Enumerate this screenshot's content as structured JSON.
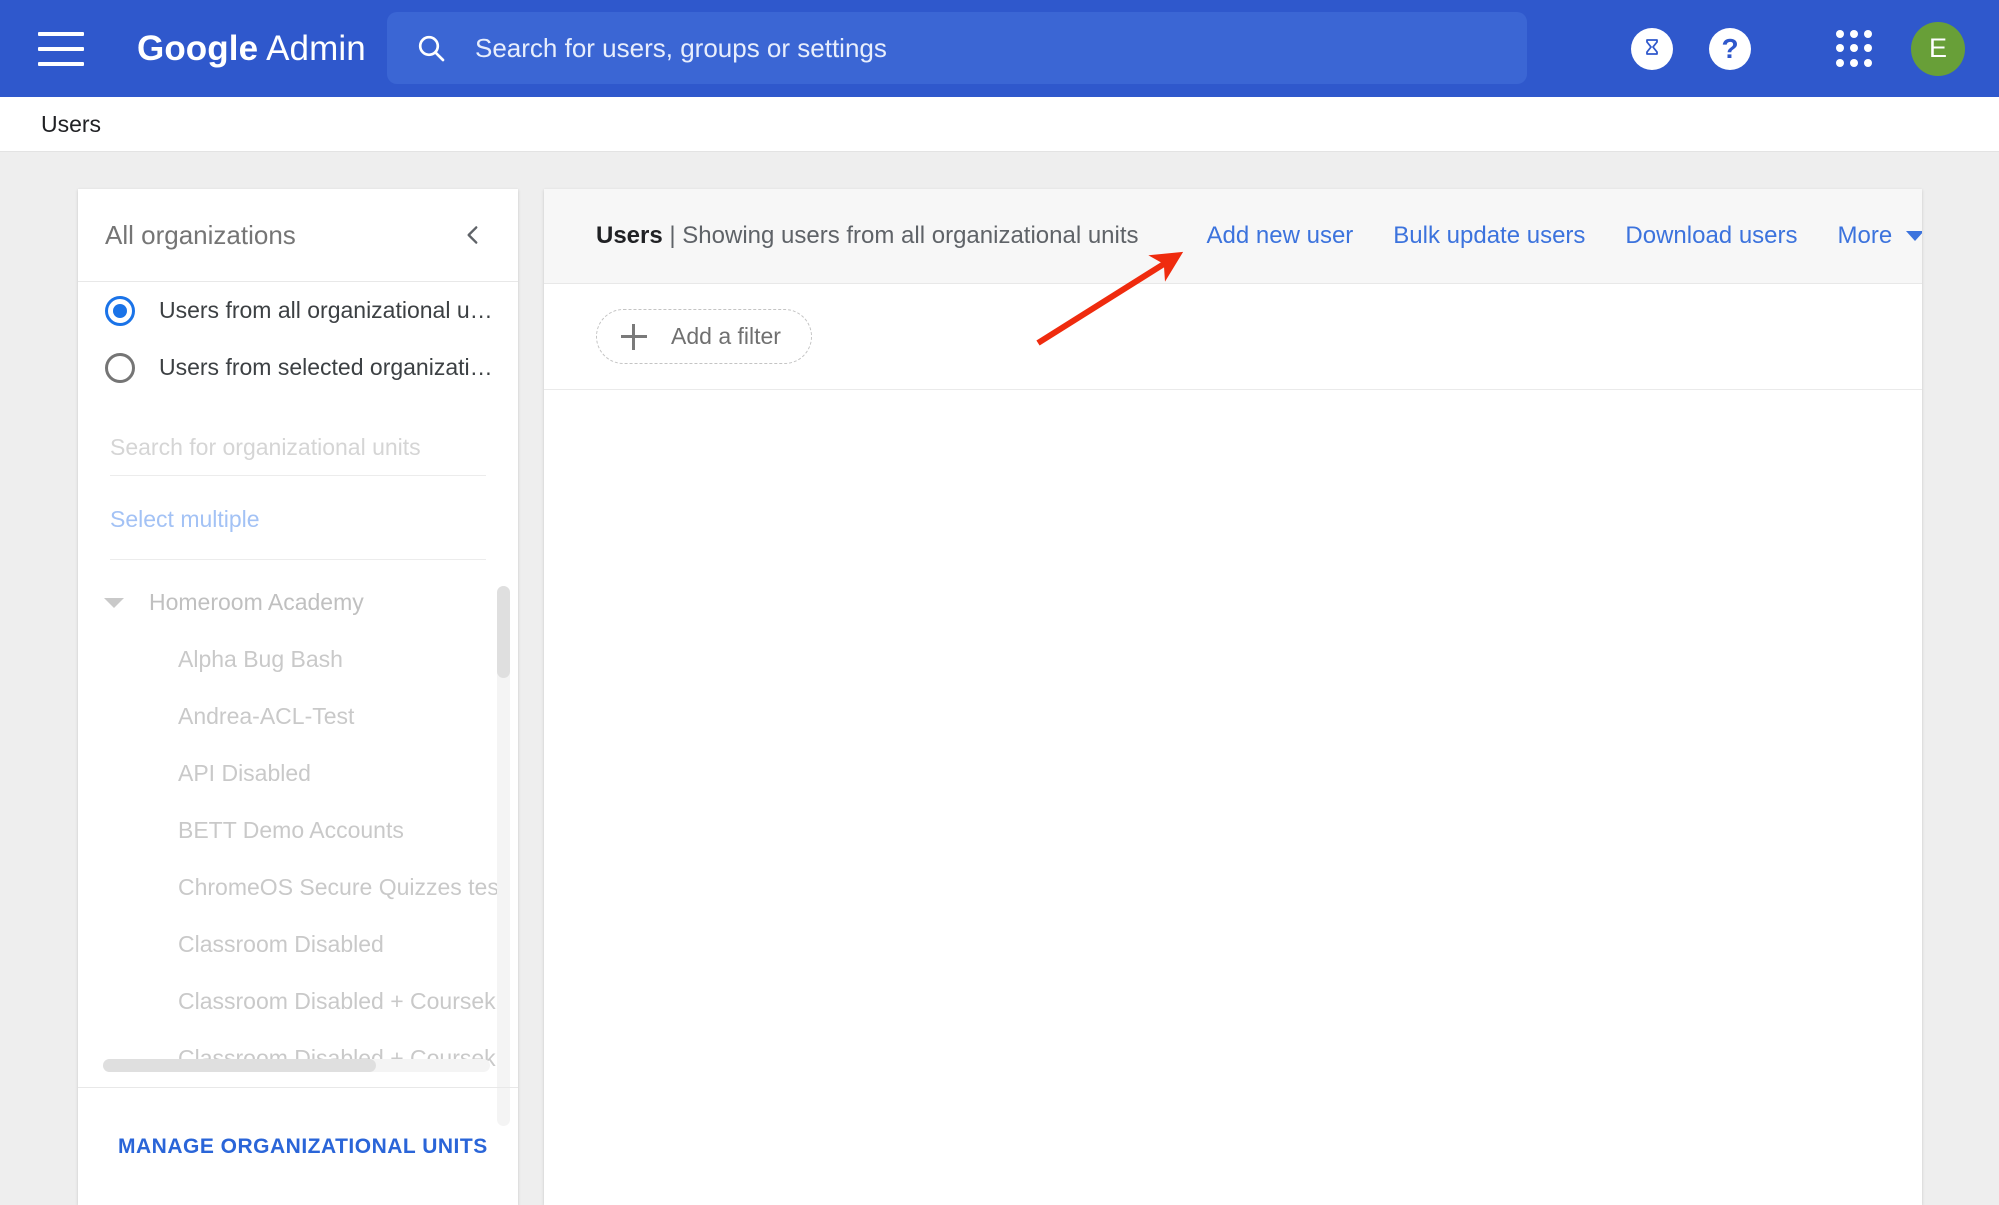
{
  "topbar": {
    "menu_icon": "hamburger-menu-icon",
    "brand_bold": "Google",
    "brand_light": "Admin",
    "search_placeholder": "Search for users, groups or settings",
    "search_icon": "search-icon",
    "trial_icon": "hourglass-icon",
    "help_icon": "help-question-icon",
    "apps_icon": "apps-grid-icon",
    "avatar_letter": "E",
    "bg_color": "#2f58cc",
    "search_bg_color": "#3b66d4",
    "avatar_color": "#689f38"
  },
  "breadcrumb": {
    "label": "Users"
  },
  "sidebar": {
    "title": "All organizations",
    "collapse_icon": "chevron-left-icon",
    "radios": [
      {
        "label": "Users from all organizational units",
        "selected": true
      },
      {
        "label": "Users from selected organizational...",
        "selected": false
      }
    ],
    "ou_search_placeholder": "Search for organizational units",
    "select_multiple_label": "Select multiple",
    "tree": [
      {
        "label": "Homeroom Academy",
        "level": "root",
        "expanded": true
      },
      {
        "label": "Alpha Bug Bash",
        "level": "child"
      },
      {
        "label": "Andrea-ACL-Test",
        "level": "child"
      },
      {
        "label": "API Disabled",
        "level": "child"
      },
      {
        "label": "BETT Demo Accounts",
        "level": "child"
      },
      {
        "label": "ChromeOS Secure Quizzes tes",
        "level": "child"
      },
      {
        "label": "Classroom Disabled",
        "level": "child"
      },
      {
        "label": "Classroom Disabled + Coursek",
        "level": "child"
      },
      {
        "label": "Classroom Disabled + Coursek",
        "level": "child"
      }
    ],
    "manage_button_label": "MANAGE ORGANIZATIONAL UNITS"
  },
  "main": {
    "title_bold": "Users",
    "title_rest": " | Showing users from all organizational units",
    "actions": [
      {
        "label": "Add new user"
      },
      {
        "label": "Bulk update users"
      },
      {
        "label": "Download users"
      }
    ],
    "more_label": "More",
    "more_icon": "chevron-down-icon",
    "filter_chip_label": "Add a filter",
    "filter_plus_icon": "plus-icon",
    "link_color": "#3c73dd"
  },
  "annotation": {
    "arrow_color": "#ef2b0e",
    "arrow_name": "red-pointer-arrow"
  }
}
